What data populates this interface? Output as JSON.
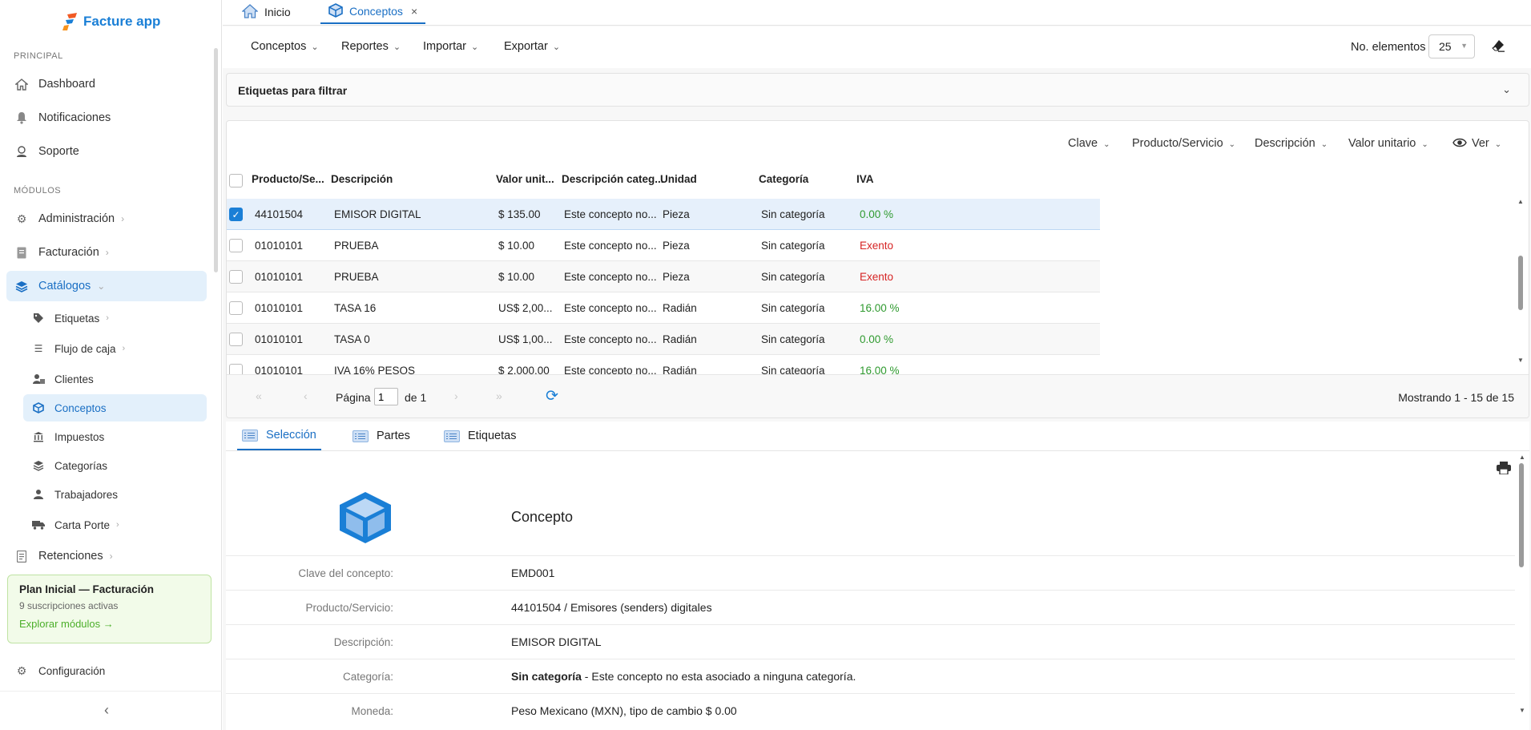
{
  "app": {
    "name": "Facture app"
  },
  "sidebar": {
    "section_principal": "PRINCIPAL",
    "section_modulos": "MÓDULOS",
    "principal_items": [
      {
        "label": "Dashboard",
        "icon": "home-icon"
      },
      {
        "label": "Notificaciones",
        "icon": "bell-icon"
      },
      {
        "label": "Soporte",
        "icon": "support-icon"
      }
    ],
    "modules": [
      {
        "label": "Administración",
        "icon": "gears-icon"
      },
      {
        "label": "Facturación",
        "icon": "invoice-icon"
      },
      {
        "label": "Catálogos",
        "icon": "layers-icon"
      }
    ],
    "catalog_items": [
      {
        "label": "Etiquetas",
        "icon": "tags-icon"
      },
      {
        "label": "Flujo de caja",
        "icon": "list-icon"
      },
      {
        "label": "Clientes",
        "icon": "users-icon"
      },
      {
        "label": "Conceptos",
        "icon": "cube-icon"
      },
      {
        "label": "Impuestos",
        "icon": "bank-icon"
      },
      {
        "label": "Categorías",
        "icon": "layers-icon"
      },
      {
        "label": "Trabajadores",
        "icon": "user-icon"
      },
      {
        "label": "Carta Porte",
        "icon": "truck-icon"
      }
    ],
    "retenciones": "Retenciones",
    "plan": {
      "title": "Plan Inicial — Facturación",
      "subtitle": "9 suscripciones activas",
      "link": "Explorar módulos →"
    },
    "config": "Configuración"
  },
  "tabs": [
    {
      "label": "Inicio"
    },
    {
      "label": "Conceptos"
    }
  ],
  "toolbar": {
    "menus": [
      "Conceptos",
      "Reportes",
      "Importar",
      "Exportar"
    ],
    "page_size_label": "No. elementos",
    "page_size": "25"
  },
  "filter": {
    "title": "Etiquetas para filtrar"
  },
  "grid": {
    "column_selectors": [
      "Clave",
      "Producto/Servicio",
      "Descripción",
      "Valor unitario",
      "Ver"
    ],
    "headers": [
      "Producto/Se...",
      "Descripción",
      "Valor unit...",
      "Descripción categ...",
      "Unidad",
      "Categoría",
      "IVA"
    ],
    "rows": [
      {
        "product": "44101504",
        "description": "EMISOR DIGITAL",
        "price": "$ 135.00",
        "cat_desc": "Este concepto no...",
        "unit": "Pieza",
        "category": "Sin categoría",
        "iva": "0.00 %"
      },
      {
        "product": "01010101",
        "description": "PRUEBA",
        "price": "$ 10.00",
        "cat_desc": "Este concepto no...",
        "unit": "Pieza",
        "category": "Sin categoría",
        "iva": "Exento"
      },
      {
        "product": "01010101",
        "description": "PRUEBA",
        "price": "$ 10.00",
        "cat_desc": "Este concepto no...",
        "unit": "Pieza",
        "category": "Sin categoría",
        "iva": "Exento"
      },
      {
        "product": "01010101",
        "description": "TASA 16",
        "price": "US$ 2,00...",
        "cat_desc": "Este concepto no...",
        "unit": "Radián",
        "category": "Sin categoría",
        "iva": "16.00 %"
      },
      {
        "product": "01010101",
        "description": "TASA 0",
        "price": "US$ 1,00...",
        "cat_desc": "Este concepto no...",
        "unit": "Radián",
        "category": "Sin categoría",
        "iva": "0.00 %"
      },
      {
        "product": "01010101",
        "description": "IVA 16% PESOS",
        "price": "$ 2,000.00",
        "cat_desc": "Este concepto no...",
        "unit": "Radián",
        "category": "Sin categoría",
        "iva": "16.00 %"
      }
    ],
    "pager": {
      "page_label": "Página",
      "page_value": "1",
      "of_label": "de 1",
      "count": "Mostrando 1 - 15 de 15"
    }
  },
  "detail": {
    "tabs": [
      "Selección",
      "Partes",
      "Etiquetas"
    ],
    "title": "Concepto",
    "fields": [
      {
        "key": "Clave del concepto:",
        "value": "EMD001"
      },
      {
        "key": "Producto/Servicio:",
        "value": "44101504 / Emisores (senders) digitales"
      },
      {
        "key": "Descripción:",
        "value": "EMISOR DIGITAL"
      },
      {
        "key": "Categoría:",
        "value_bold": "Sin categoría",
        "value": " - Este concepto no esta asociado a ninguna categoría."
      },
      {
        "key": "Moneda:",
        "value": "Peso Mexicano (MXN), tipo de cambio $ 0.00"
      }
    ]
  },
  "colors": {
    "accent": "#1a7fd6",
    "active_bg": "#e3f0fb",
    "green": "#2f9a2f",
    "red": "#d62424"
  }
}
